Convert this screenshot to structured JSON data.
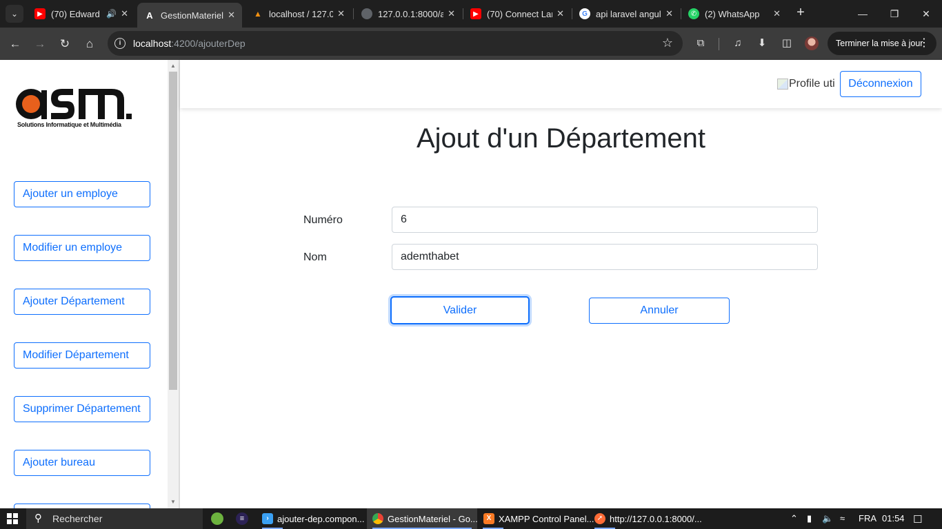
{
  "browser": {
    "tabs": [
      {
        "title": "(70) Edward",
        "icon": "youtube-icon",
        "color": "#ff0000",
        "audio": true
      },
      {
        "title": "GestionMateriel",
        "icon": "angular-icon",
        "color": "#dd0031",
        "active": true
      },
      {
        "title": "localhost / 127.0",
        "icon": "phpmyadmin-icon",
        "color": "#f29111"
      },
      {
        "title": "127.0.0.1:8000/a",
        "icon": "globe-icon",
        "color": "#9aa0a6"
      },
      {
        "title": "(70) Connect Lar",
        "icon": "youtube-icon",
        "color": "#ff0000"
      },
      {
        "title": "api laravel angul",
        "icon": "google-icon",
        "color": "#4285f4"
      },
      {
        "title": "(2) WhatsApp",
        "icon": "whatsapp-icon",
        "color": "#25d366"
      }
    ],
    "url_host": "localhost",
    "url_rest": ":4200/ajouterDep",
    "update_label": "Terminer la mise à jour"
  },
  "sidebar": {
    "logo_text": "asm.",
    "logo_tagline": "Solutions Informatique et Multimédia",
    "items": [
      {
        "label": "Ajouter un employe"
      },
      {
        "label": "Modifier un employe"
      },
      {
        "label": "Ajouter Département"
      },
      {
        "label": "Modifier Département"
      },
      {
        "label": "Supprimer Département"
      },
      {
        "label": "Ajouter bureau"
      },
      {
        "label": ""
      }
    ]
  },
  "header": {
    "profile_alt": "Profile uti",
    "logout_label": "Déconnexion"
  },
  "form": {
    "title": "Ajout d'un Département",
    "numero_label": "Numéro",
    "numero_value": "6",
    "nom_label": "Nom",
    "nom_value": "ademthabet",
    "submit_label": "Valider",
    "cancel_label": "Annuler"
  },
  "taskbar": {
    "search_placeholder": "Rechercher",
    "apps": [
      {
        "label": "ajouter-dep.compon...",
        "icon": "vscode-icon",
        "color": "#3aa0f3"
      },
      {
        "label": "GestionMateriel - Go...",
        "icon": "chrome-icon",
        "color": "#fbbc04",
        "active": true
      },
      {
        "label": "XAMPP Control Panel...",
        "icon": "xampp-icon",
        "color": "#fb7a24"
      },
      {
        "label": "http://127.0.0.1:8000/...",
        "icon": "postman-icon",
        "color": "#ff6c37"
      }
    ],
    "language": "FRA",
    "time": "01:54"
  },
  "colors": {
    "primary": "#0d6efd",
    "logo_orange": "#e8601c"
  }
}
